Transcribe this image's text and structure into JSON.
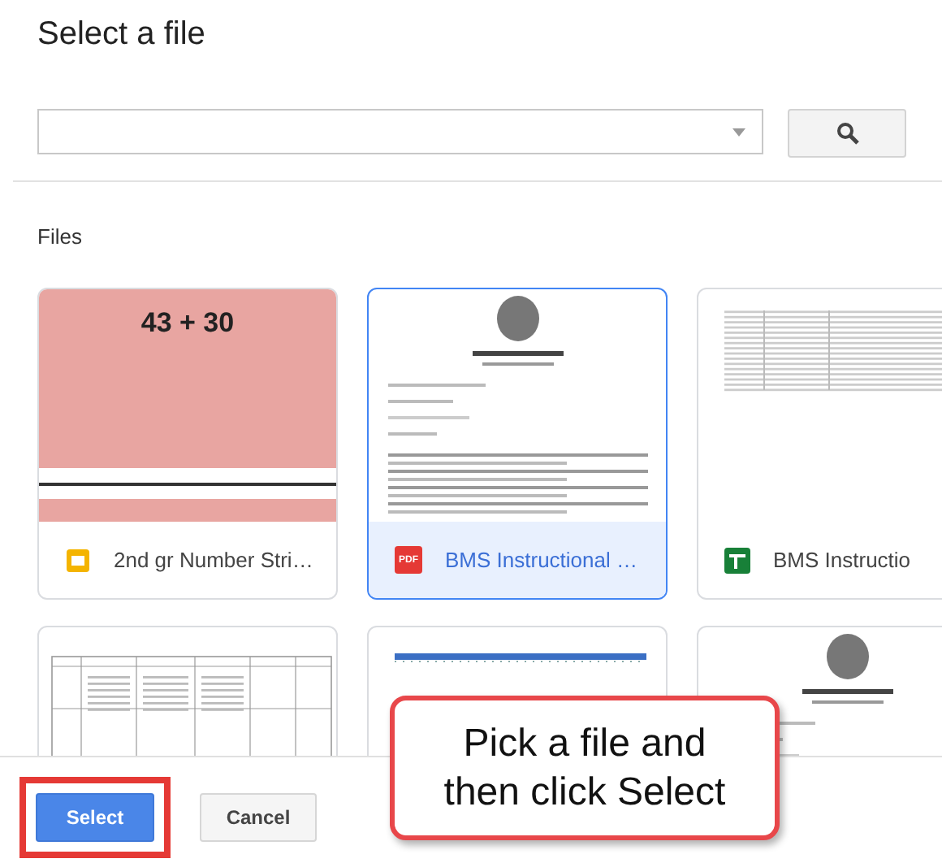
{
  "dialog": {
    "title": "Select a file"
  },
  "section_label": "Files",
  "files": [
    {
      "kind": "slides",
      "name": "2nd gr Number Stri…",
      "selected": false,
      "preview": {
        "kind": "number-card",
        "text": "43 + 30"
      }
    },
    {
      "kind": "pdf",
      "icon_label": "PDF",
      "name": "BMS Instructional …",
      "selected": true,
      "preview": {
        "kind": "letter-doc"
      }
    },
    {
      "kind": "sheets",
      "name": "BMS Instructio",
      "selected": false,
      "preview": {
        "kind": "spreadsheet"
      }
    },
    {
      "selected": false,
      "preview": {
        "kind": "table-doc"
      }
    },
    {
      "selected": false,
      "preview": {
        "kind": "ruler"
      }
    },
    {
      "selected": false,
      "preview": {
        "kind": "letter-doc"
      }
    }
  ],
  "buttons": [
    {
      "label": "Select",
      "kind": "primary",
      "highlighted": true
    },
    {
      "label": "Cancel",
      "kind": "secondary",
      "highlighted": false
    }
  ],
  "callout": {
    "text": "Pick a file and then click Select"
  }
}
